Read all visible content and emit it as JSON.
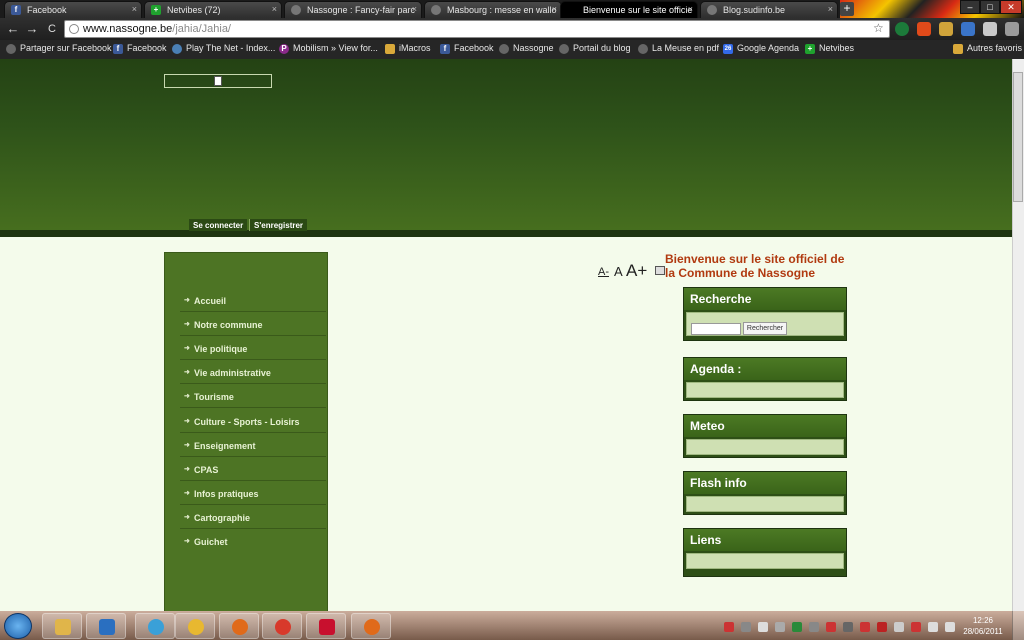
{
  "tabs": [
    {
      "title": "Facebook",
      "icon": "facebook-icon",
      "color": "#3b5998",
      "glyph": "f"
    },
    {
      "title": "Netvibes (72)",
      "icon": "netvibes-icon",
      "color": "#1fa22e",
      "glyph": "+"
    },
    {
      "title": "Nassogne : Fancy-fair parc",
      "icon": "blog-icon",
      "color": "#777",
      "glyph": ""
    },
    {
      "title": "Masbourg : messe en wallo",
      "icon": "blog-icon",
      "color": "#777",
      "glyph": ""
    },
    {
      "title": "Bienvenue sur le site officie",
      "icon": "page-icon",
      "color": "#000",
      "glyph": ""
    },
    {
      "title": "Blog.sudinfo.be",
      "icon": "blog-icon",
      "color": "#777",
      "glyph": ""
    }
  ],
  "tab_close": "×",
  "new_tab": "+",
  "window_controls": {
    "minimize": "–",
    "maximize": "□",
    "close": "✕"
  },
  "nav": {
    "back": "←",
    "forward": "→",
    "reload": "C"
  },
  "address": {
    "host": "www.nassogne.be",
    "path": "/jahia/Jahia/"
  },
  "bookmark_star": "☆",
  "bookmarks": [
    {
      "label": "Partager sur Facebook",
      "icon": "blog-icon",
      "color": "#666",
      "glyph": ""
    },
    {
      "label": "Facebook",
      "icon": "facebook-icon",
      "color": "#3b5998",
      "glyph": "f"
    },
    {
      "label": "Play The Net - Index...",
      "icon": "globe-icon",
      "color": "#4a7fb5",
      "glyph": ""
    },
    {
      "label": "Mobilism » View for...",
      "icon": "mobilism-icon",
      "color": "#8a2a8a",
      "glyph": "P"
    },
    {
      "label": "iMacros",
      "icon": "folder-icon",
      "color": "#d9a93a",
      "glyph": ""
    },
    {
      "label": "Facebook",
      "icon": "facebook-icon",
      "color": "#3b5998",
      "glyph": "f"
    },
    {
      "label": "Nassogne",
      "icon": "blog-icon",
      "color": "#666",
      "glyph": ""
    },
    {
      "label": "Portail du blog",
      "icon": "blog-icon",
      "color": "#666",
      "glyph": ""
    },
    {
      "label": "La Meuse en pdf",
      "icon": "blog-icon",
      "color": "#666",
      "glyph": ""
    },
    {
      "label": "Google Agenda",
      "icon": "calendar-icon",
      "color": "#3369e8",
      "glyph": "26"
    },
    {
      "label": "Netvibes",
      "icon": "netvibes-icon",
      "color": "#1fa22e",
      "glyph": "+"
    }
  ],
  "other_bookmarks": "Autres favoris",
  "header": {
    "login": "Se connecter",
    "register": "S'enregistrer"
  },
  "menu": [
    "Accueil",
    "Notre commune",
    "Vie politique",
    "Vie administrative",
    "Tourisme",
    "Culture - Sports - Loisirs",
    "Enseignement",
    "CPAS",
    "Infos pratiques",
    "Cartographie",
    "Guichet"
  ],
  "text_size": {
    "small": "A-",
    "normal": "A",
    "large": "A+"
  },
  "welcome": "Bienvenue sur le site officiel de la Commune de Nassogne",
  "boxes": {
    "recherche": "Recherche",
    "agenda": "Agenda :",
    "meteo": "Meteo",
    "flash": "Flash info",
    "liens": "Liens"
  },
  "search": {
    "value": "",
    "button": "Rechercher"
  },
  "clock": {
    "time": "12:26",
    "date": "28/06/2011"
  },
  "colors": {
    "header": "#2d5119",
    "menu": "#4d7424",
    "accent": "#b13a10",
    "box": "#3a6419"
  }
}
